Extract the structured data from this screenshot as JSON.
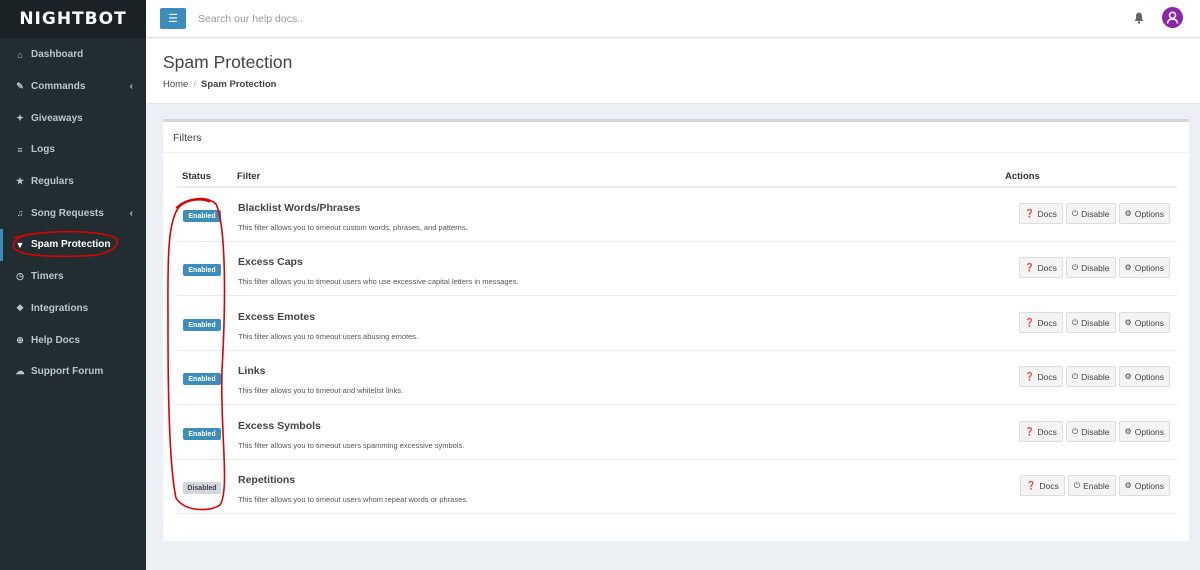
{
  "app": {
    "logo": "NIGHTBOT"
  },
  "sidebar": {
    "items": [
      {
        "label": "Dashboard",
        "icon": "dashboard-icon",
        "glyph": "⌂"
      },
      {
        "label": "Commands",
        "icon": "magic-wand-icon",
        "glyph": "✎",
        "chevron": "‹"
      },
      {
        "label": "Giveaways",
        "icon": "gift-icon",
        "glyph": "✦"
      },
      {
        "label": "Logs",
        "icon": "database-icon",
        "glyph": "≡"
      },
      {
        "label": "Regulars",
        "icon": "star-icon",
        "glyph": "★"
      },
      {
        "label": "Song Requests",
        "icon": "music-icon",
        "glyph": "♫",
        "chevron": "‹"
      },
      {
        "label": "Spam Protection",
        "icon": "filter-icon",
        "glyph": "▼",
        "active": true
      },
      {
        "label": "Timers",
        "icon": "clock-icon",
        "glyph": "◷"
      },
      {
        "label": "Integrations",
        "icon": "cubes-icon",
        "glyph": "❖"
      },
      {
        "label": "Help Docs",
        "icon": "life-ring-icon",
        "glyph": "⊕"
      },
      {
        "label": "Support Forum",
        "icon": "comments-icon",
        "glyph": "☁"
      }
    ]
  },
  "topbar": {
    "search_placeholder": "Search our help docs.."
  },
  "header": {
    "title": "Spam Protection",
    "breadcrumb": {
      "home": "Home",
      "current": "Spam Protection"
    }
  },
  "filters": {
    "title": "Filters",
    "columns": {
      "status": "Status",
      "filter": "Filter",
      "actions": "Actions"
    },
    "rows": [
      {
        "status": "Enabled",
        "name": "Blacklist Words/Phrases",
        "desc": "This filter allows you to timeout custom words, phrases, and patterns.",
        "docs": "Docs",
        "toggle": "Disable",
        "options": "Options"
      },
      {
        "status": "Enabled",
        "name": "Excess Caps",
        "desc": "This filter allows you to timeout users who use excessive capital letters in messages.",
        "docs": "Docs",
        "toggle": "Disable",
        "options": "Options"
      },
      {
        "status": "Enabled",
        "name": "Excess Emotes",
        "desc": "This filter allows you to timeout users abusing emotes.",
        "docs": "Docs",
        "toggle": "Disable",
        "options": "Options"
      },
      {
        "status": "Enabled",
        "name": "Links",
        "desc": "This filter allows you to timeout and whitelist links.",
        "docs": "Docs",
        "toggle": "Disable",
        "options": "Options"
      },
      {
        "status": "Enabled",
        "name": "Excess Symbols",
        "desc": "This filter allows you to timeout users spamming excessive symbols.",
        "docs": "Docs",
        "toggle": "Disable",
        "options": "Options"
      },
      {
        "status": "Disabled",
        "name": "Repetitions",
        "desc": "This filter allows you to timeout users whom repeat words or phrases.",
        "docs": "Docs",
        "toggle": "Enable",
        "options": "Options"
      }
    ]
  },
  "colors": {
    "accent": "#3c8dbc",
    "sidebar": "#222d32",
    "annotation": "#e00000",
    "avatar": "#8e24aa"
  }
}
